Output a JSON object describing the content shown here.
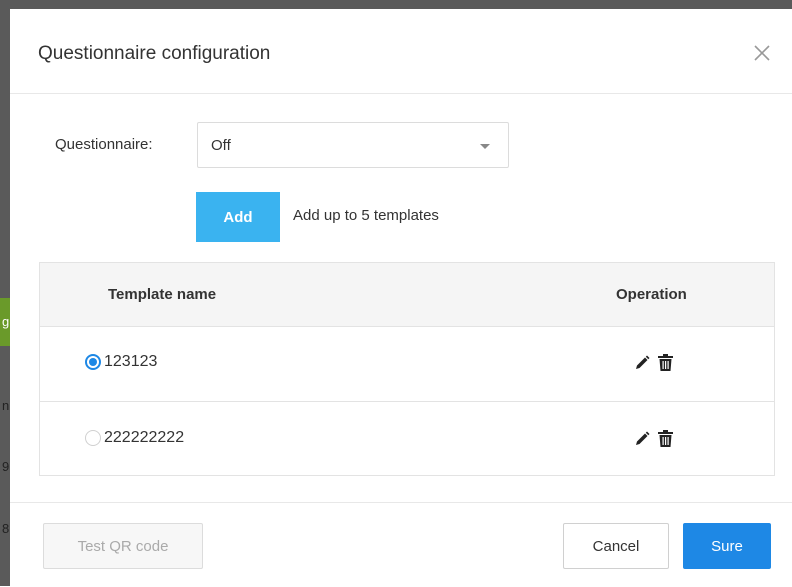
{
  "dialog": {
    "title": "Questionnaire configuration",
    "close_icon": "close-icon"
  },
  "questionnaire": {
    "label": "Questionnaire:",
    "selected": "Off"
  },
  "add": {
    "label": "Add",
    "hint": "Add up to 5 templates"
  },
  "table": {
    "headers": [
      "Template name",
      "Operation"
    ],
    "rows": [
      {
        "name": "123123",
        "selected": true
      },
      {
        "name": "222222222",
        "selected": false
      }
    ]
  },
  "footer": {
    "test_label": "Test QR code",
    "cancel_label": "Cancel",
    "sure_label": "Sure"
  },
  "background_fragments": [
    "g",
    "n",
    "9",
    "8"
  ],
  "colors": {
    "accent": "#1e88e5",
    "add_button": "#3ab3f0"
  }
}
